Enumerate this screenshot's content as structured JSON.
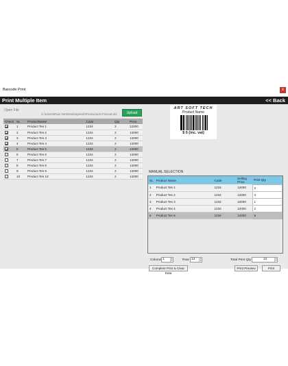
{
  "window": {
    "title": "Barcode Print",
    "close_label": "x"
  },
  "header": {
    "title": "Print Multiple Item",
    "back_label": "<< Back"
  },
  "file": {
    "open_label": "Open File",
    "path": "C:\\Users\\Riaz.Net\\Desktop\\test\\ProductList Format.xls",
    "upload_label": "Upload"
  },
  "products": {
    "columns": [
      "Check",
      "SL",
      "ProductName",
      "Code",
      "Qty",
      "Price"
    ],
    "rows": [
      {
        "checked": true,
        "sl": "1",
        "name": "Product Tes 1",
        "code": "1234",
        "qty": "2",
        "price": "12000"
      },
      {
        "checked": true,
        "sl": "2",
        "name": "Product Tes 2",
        "code": "1234",
        "qty": "2",
        "price": "12000"
      },
      {
        "checked": true,
        "sl": "3",
        "name": "Product Tes 3",
        "code": "1234",
        "qty": "2",
        "price": "12000"
      },
      {
        "checked": true,
        "sl": "4",
        "name": "Product Tes 4",
        "code": "1234",
        "qty": "2",
        "price": "12000"
      },
      {
        "checked": true,
        "sl": "5",
        "name": "Product Tes 5",
        "code": "1234",
        "qty": "2",
        "price": "12000",
        "selected": true
      },
      {
        "checked": false,
        "sl": "6",
        "name": "Product Tes 6",
        "code": "1234",
        "qty": "2",
        "price": "12000"
      },
      {
        "checked": false,
        "sl": "7",
        "name": "Product Tes 7",
        "code": "1234",
        "qty": "2",
        "price": "12000"
      },
      {
        "checked": false,
        "sl": "8",
        "name": "Product Tes 8",
        "code": "1234",
        "qty": "2",
        "price": "12000"
      },
      {
        "checked": false,
        "sl": "9",
        "name": "Product Tes 9",
        "code": "1234",
        "qty": "2",
        "price": "12000"
      },
      {
        "checked": false,
        "sl": "10",
        "name": "Product Tes 10",
        "code": "1234",
        "qty": "2",
        "price": "12000"
      }
    ]
  },
  "preview": {
    "brand": "ART SOFT TECH",
    "product_name": "Product Name",
    "price": "$ 0 (inc. vat)"
  },
  "manual": {
    "label": "MANUAL SELECTION",
    "columns": [
      "SL",
      "Product Name",
      "Code",
      "Selling Price",
      "Print Qty"
    ],
    "rows": [
      {
        "sl": "1",
        "name": "Product Tes 1",
        "code": "1234",
        "price": "12000",
        "qty": "2"
      },
      {
        "sl": "2",
        "name": "Product Tes 2",
        "code": "1234",
        "price": "12000",
        "qty": "3"
      },
      {
        "sl": "3",
        "name": "Product Tes 3",
        "code": "1234",
        "price": "12000",
        "qty": "1"
      },
      {
        "sl": "4",
        "name": "Product Tes 4",
        "code": "1234",
        "price": "12000",
        "qty": "2"
      },
      {
        "sl": "5",
        "name": "Product Tes 5",
        "code": "1234",
        "price": "12000",
        "qty": "5",
        "selected": true
      }
    ]
  },
  "controls": {
    "column_label": "Column",
    "column_value": "1",
    "row_label": "Row",
    "row_value": "13",
    "total_label": "Total Print Qty",
    "total_value": "13",
    "complete_label": "Complete Print & Clear Data",
    "preview_label": "Print Preview",
    "print_label": "Print"
  }
}
